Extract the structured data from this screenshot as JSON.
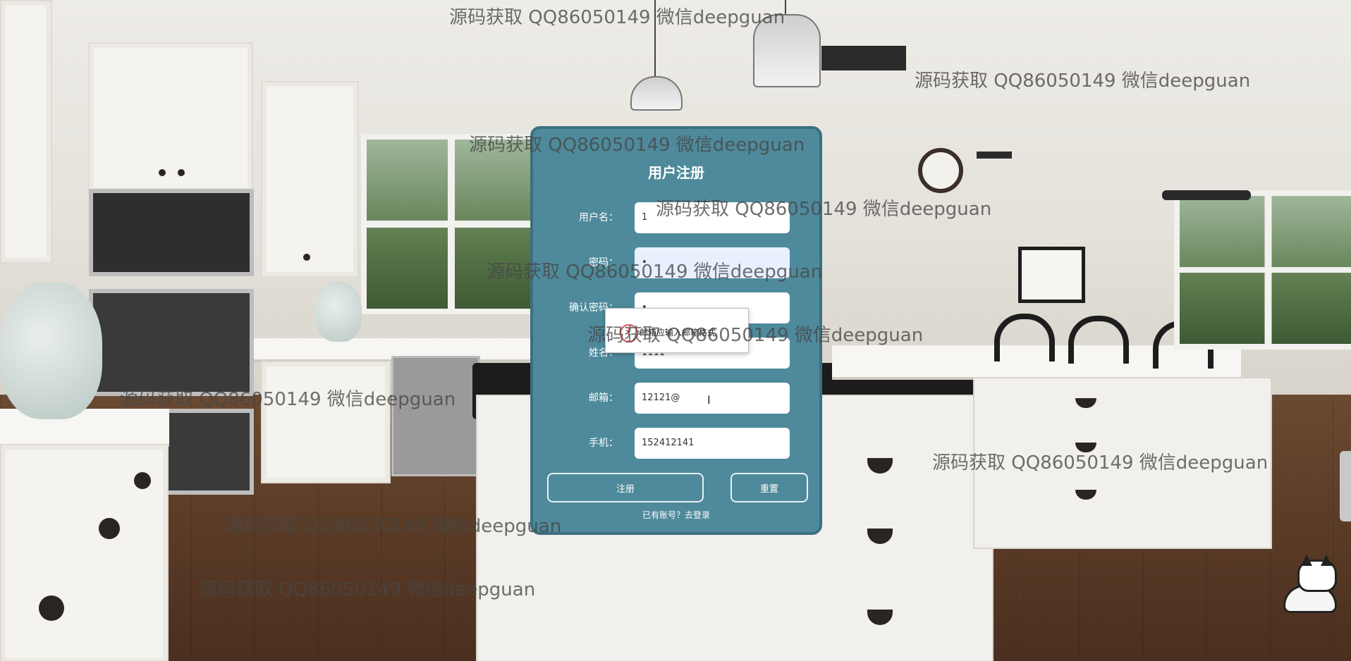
{
  "watermark": "源码获取 QQ86050149 微信deepguan",
  "form": {
    "title": "用户注册",
    "username": {
      "label": "用户名：",
      "value": "1"
    },
    "password": {
      "label": "密码：",
      "value": "•"
    },
    "confirm_password": {
      "label": "确认密码：",
      "value": "•"
    },
    "name": {
      "label": "姓名：",
      "value": "1111"
    },
    "email": {
      "label": "邮箱：",
      "value": "12121@"
    },
    "phone": {
      "label": "手机：",
      "value": "152412141"
    },
    "register_button": "注册",
    "reset_button": "重置",
    "login_link": "已有账号？去登录"
  },
  "tooltip": {
    "icon": "!",
    "message": "邮箱应输入邮箱格式"
  },
  "colors": {
    "dialog_bg": "#4e8a9b",
    "dialog_border": "#3c6f80",
    "text": "#ffffff"
  }
}
